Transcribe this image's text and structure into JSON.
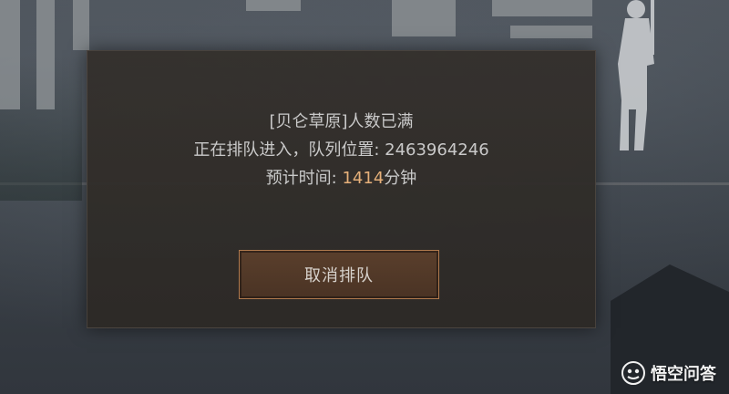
{
  "queue_dialog": {
    "server_full_text": "[贝仑草原]人数已满",
    "queue_status_prefix": "正在排队进入，队列位置: ",
    "queue_position": "2463964246",
    "estimated_time_prefix": "预计时间: ",
    "estimated_time_value": "1414",
    "estimated_time_unit": "分钟",
    "cancel_button_label": "取消排队"
  },
  "watermark": {
    "text": "悟空问答",
    "icon": "wukong-logo-icon"
  },
  "colors": {
    "highlight": "#e6b07a",
    "button_border": "#b07a4e",
    "dialog_bg": "#34302c"
  }
}
